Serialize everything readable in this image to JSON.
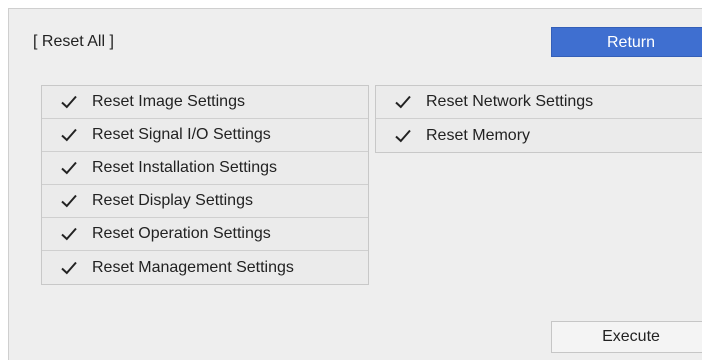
{
  "header": {
    "title": "[ Reset All ]",
    "return_label": "Return"
  },
  "left_list": {
    "items": [
      {
        "label": "Reset Image Settings",
        "checked": true,
        "icon": "checkmark-icon"
      },
      {
        "label": "Reset Signal I/O Settings",
        "checked": true,
        "icon": "checkmark-icon"
      },
      {
        "label": "Reset Installation Settings",
        "checked": true,
        "icon": "checkmark-icon"
      },
      {
        "label": "Reset Display Settings",
        "checked": true,
        "icon": "checkmark-icon"
      },
      {
        "label": "Reset Operation Settings",
        "checked": true,
        "icon": "checkmark-icon"
      },
      {
        "label": "Reset Management Settings",
        "checked": true,
        "icon": "checkmark-icon"
      }
    ]
  },
  "right_list": {
    "items": [
      {
        "label": "Reset Network Settings",
        "checked": true,
        "icon": "checkmark-icon"
      },
      {
        "label": "Reset Memory",
        "checked": true,
        "icon": "checkmark-icon"
      }
    ]
  },
  "footer": {
    "execute_label": "Execute"
  },
  "colors": {
    "panel_bg": "#eeeeee",
    "return_bg": "#3f6fd0",
    "text": "#222222"
  }
}
